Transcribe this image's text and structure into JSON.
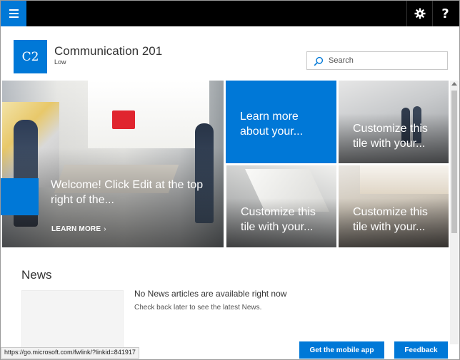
{
  "suite_bar": {
    "app_launcher_icon": "waffle-menu-icon",
    "settings_icon": "gear-icon",
    "help_label": "?"
  },
  "site": {
    "logo_text": "C2",
    "title": "Communication 201",
    "subtitle": "Low"
  },
  "search": {
    "placeholder": "Search",
    "icon": "search-icon"
  },
  "hero": {
    "main_tile": {
      "caption": "Welcome! Click Edit at the top right of the...",
      "link_label": "LEARN MORE",
      "link_chevron": "›"
    },
    "tiles": [
      {
        "caption": "Learn more about your..."
      },
      {
        "caption": "Customize this tile with your..."
      },
      {
        "caption": "Customize this tile with your..."
      },
      {
        "caption": "Customize this tile with your..."
      }
    ]
  },
  "news": {
    "title": "News",
    "empty_message": "No News articles are available right now",
    "hint": "Check back later to see the latest News."
  },
  "footer": {
    "status_url": "https://go.microsoft.com/fwlink/?linkid=841917",
    "mobile_app_label": "Get the mobile app",
    "feedback_label": "Feedback"
  },
  "colors": {
    "accent": "#0078d7",
    "suite_bar": "#000000"
  }
}
